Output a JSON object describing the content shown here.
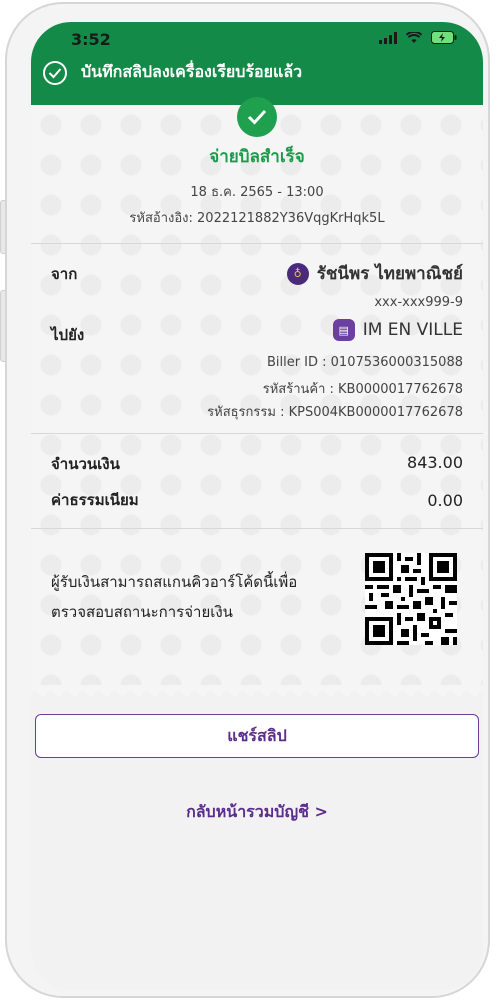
{
  "status_bar": {
    "time": "3:52"
  },
  "header": {
    "title": "บันทึกสลิปลงเครื่องเรียบร้อยแล้ว"
  },
  "receipt": {
    "success_title": "จ่ายบิลสำเร็จ",
    "datetime": "18 ธ.ค. 2565 - 13:00",
    "reference": "รหัสอ้างอิง: 2022121882Y36VqgKrHqk5L",
    "from_label": "จาก",
    "from_name": "รัชนีพร ไทยพาณิชย์",
    "from_account": "xxx-xxx999-9",
    "to_label": "ไปยัง",
    "to_name": "IM EN VILLE",
    "biller_id": "Biller ID : 0107536000315088",
    "merchant_code": "รหัสร้านค้า : KB0000017762678",
    "transaction_code": "รหัสธุรกรรม : KPS004KB0000017762678",
    "amount_label": "จำนวนเงิน",
    "amount_value": "843.00",
    "fee_label": "ค่าธรรมเนียม",
    "fee_value": "0.00",
    "qr_text_line1": "ผู้รับเงินสามารถสแกนคิวอาร์โค้ดนี้เพื่อ",
    "qr_text_line2": "ตรวจสอบสถานะการจ่ายเงิน"
  },
  "actions": {
    "share_label": "แชร์สลิป",
    "back_label": "กลับหน้ารวมบัญชี >"
  },
  "colors": {
    "header": "#138a48",
    "success": "#1e9a4c",
    "accent": "#5b2d8c"
  }
}
